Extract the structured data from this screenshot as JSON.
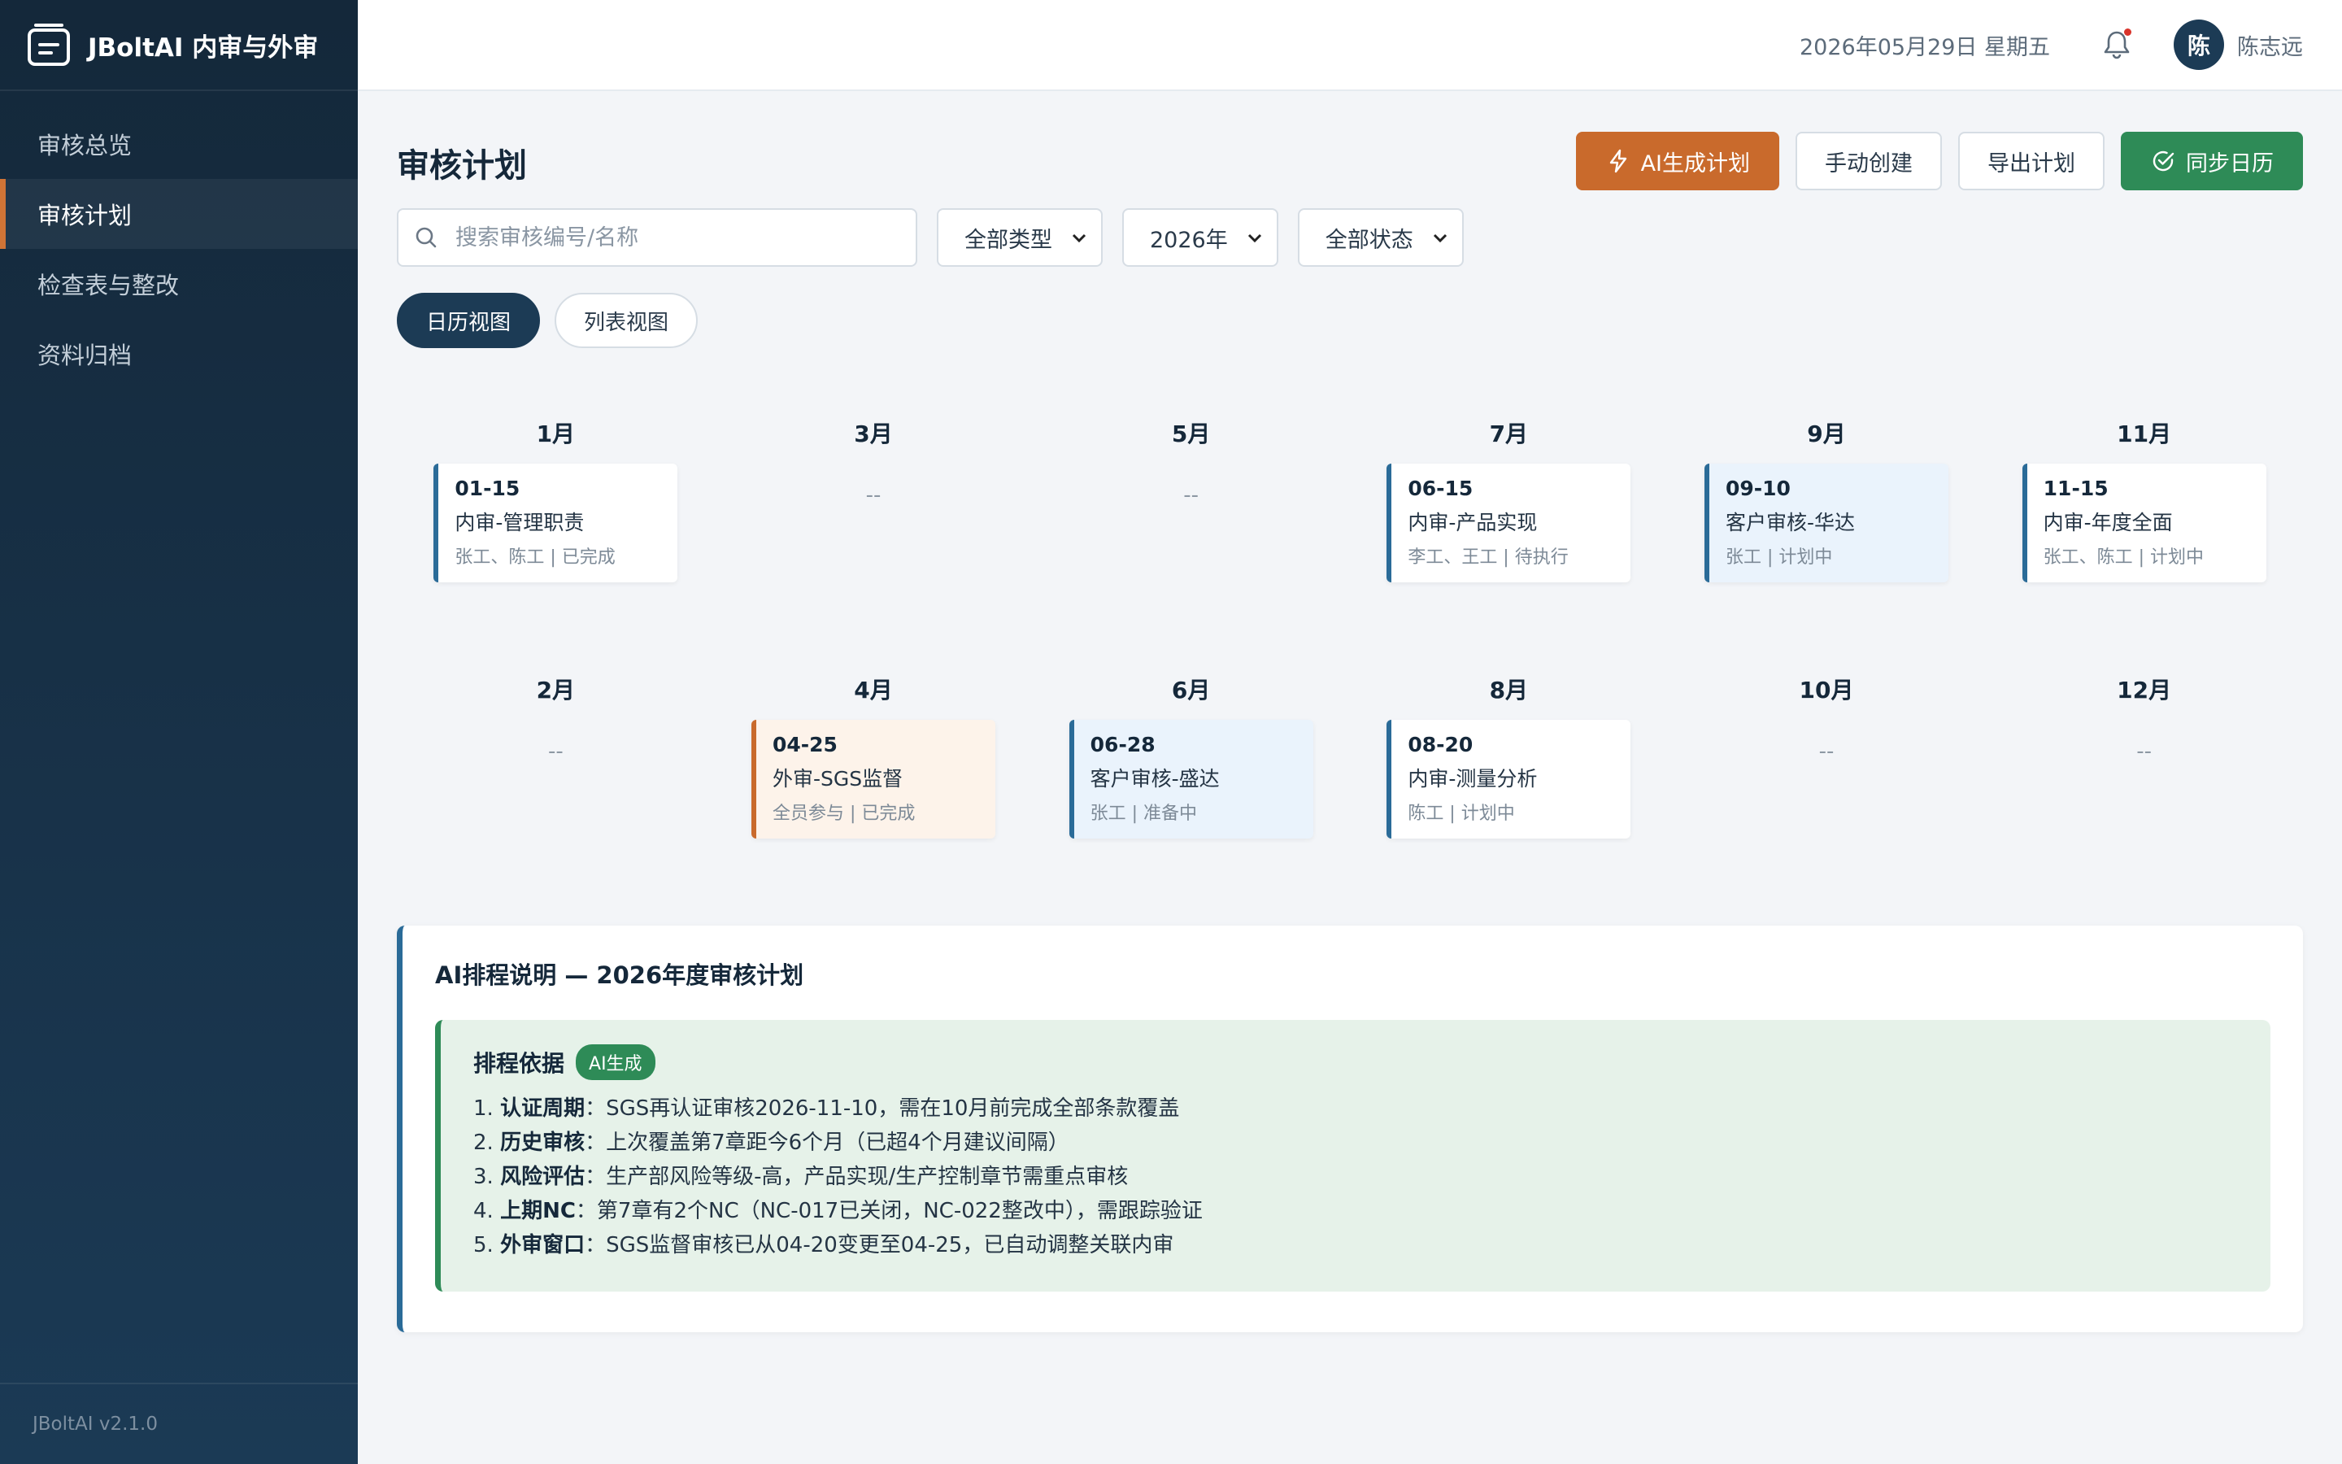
{
  "brand": {
    "title": "JBoltAI 内审与外审",
    "version": "JBoltAI v2.1.0"
  },
  "sidebar": {
    "items": [
      {
        "label": "审核总览",
        "active": false
      },
      {
        "label": "审核计划",
        "active": true
      },
      {
        "label": "检查表与整改",
        "active": false
      },
      {
        "label": "资料归档",
        "active": false
      }
    ]
  },
  "topbar": {
    "date": "2026年05月29日 星期五",
    "avatar_text": "陈",
    "user_name": "陈志远"
  },
  "page": {
    "title": "审核计划"
  },
  "toolbar": {
    "ai_label": "AI生成计划",
    "manual_label": "手动创建",
    "export_label": "导出计划",
    "sync_label": "同步日历"
  },
  "filters": {
    "search_placeholder": "搜索审核编号/名称",
    "type_value": "全部类型",
    "year_value": "2026年",
    "status_value": "全部状态"
  },
  "views": {
    "calendar": "日历视图",
    "list": "列表视图"
  },
  "calendar": {
    "empty_text": "--",
    "months": [
      {
        "label": "1月",
        "event": {
          "date": "01-15",
          "title": "内审-管理职责",
          "meta": "张工、陈工 | 已完成",
          "style": "white"
        }
      },
      {
        "label": "3月",
        "event": null
      },
      {
        "label": "5月",
        "event": null
      },
      {
        "label": "7月",
        "event": {
          "date": "06-15",
          "title": "内审-产品实现",
          "meta": "李工、王工 | 待执行",
          "style": "white"
        }
      },
      {
        "label": "9月",
        "event": {
          "date": "09-10",
          "title": "客户审核-华达",
          "meta": "张工 | 计划中",
          "style": "blue"
        }
      },
      {
        "label": "11月",
        "event": {
          "date": "11-15",
          "title": "内审-年度全面",
          "meta": "张工、陈工 | 计划中",
          "style": "white"
        }
      },
      {
        "label": "2月",
        "event": null
      },
      {
        "label": "4月",
        "event": {
          "date": "04-25",
          "title": "外审-SGS监督",
          "meta": "全员参与 | 已完成",
          "style": "orange"
        }
      },
      {
        "label": "6月",
        "event": {
          "date": "06-28",
          "title": "客户审核-盛达",
          "meta": "张工 | 准备中",
          "style": "blue"
        }
      },
      {
        "label": "8月",
        "event": {
          "date": "08-20",
          "title": "内审-测量分析",
          "meta": "陈工 | 计划中",
          "style": "white"
        }
      },
      {
        "label": "10月",
        "event": null
      },
      {
        "label": "12月",
        "event": null
      }
    ]
  },
  "ai_note": {
    "title": "AI排程说明 — 2026年度审核计划",
    "basis_title": "排程依据",
    "badge": "AI生成",
    "reasons": [
      {
        "num": "1.",
        "key": "认证周期",
        "text": "：SGS再认证审核2026-11-10，需在10月前完成全部条款覆盖"
      },
      {
        "num": "2.",
        "key": "历史审核",
        "text": "：上次覆盖第7章距今6个月（已超4个月建议间隔）"
      },
      {
        "num": "3.",
        "key": "风险评估",
        "text": "：生产部风险等级-高，产品实现/生产控制章节需重点审核"
      },
      {
        "num": "4.",
        "key": "上期NC",
        "text": "：第7章有2个NC（NC-017已关闭，NC-022整改中），需跟踪验证"
      },
      {
        "num": "5.",
        "key": "外审窗口",
        "text": "：SGS监督审核已从04-20变更至04-25，已自动调整关联内审"
      }
    ]
  },
  "colors": {
    "accent_orange": "#c96a2c",
    "accent_green": "#2e8b57",
    "navy": "#1c3b55",
    "event_blue": "#2a6b98"
  }
}
